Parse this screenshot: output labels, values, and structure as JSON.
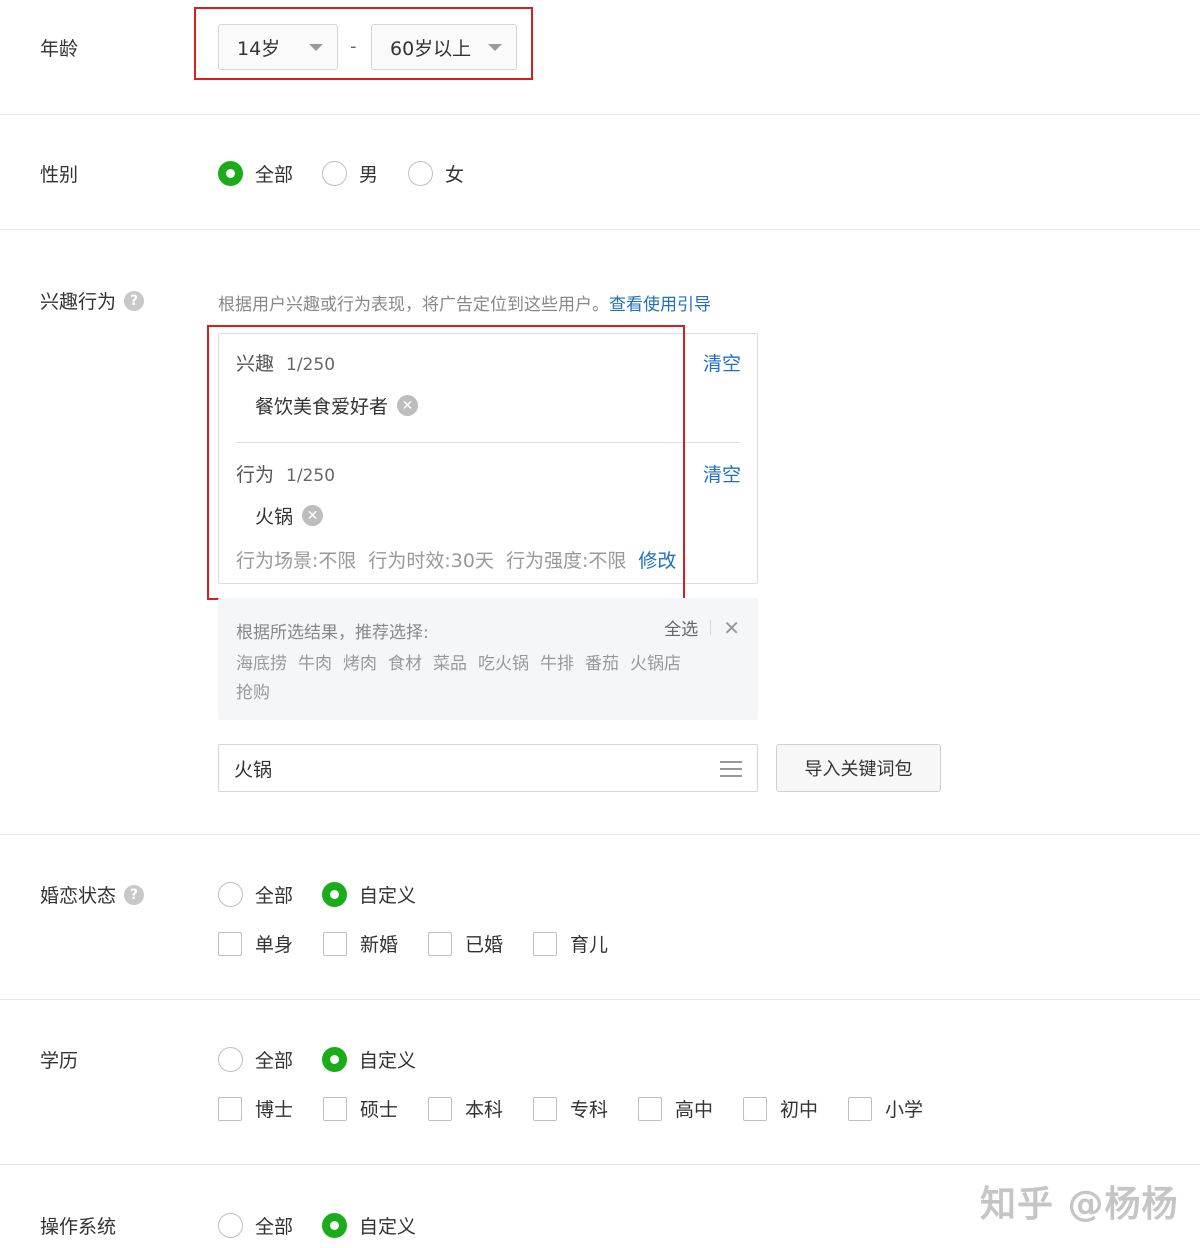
{
  "age": {
    "label": "年龄",
    "from": "14岁",
    "to": "60岁以上",
    "separator": "-"
  },
  "gender": {
    "label": "性别",
    "options": [
      {
        "label": "全部",
        "selected": true
      },
      {
        "label": "男",
        "selected": false
      },
      {
        "label": "女",
        "selected": false
      }
    ]
  },
  "interest_behavior": {
    "label": "兴趣行为",
    "help_icon": "question-circle-icon",
    "description": "根据用户兴趣或行为表现，将广告定位到这些用户。",
    "guide_link": "查看使用引导",
    "interest": {
      "title": "兴趣",
      "count": "1/250",
      "clear": "清空",
      "tags": [
        "餐饮美食爱好者"
      ]
    },
    "behavior": {
      "title": "行为",
      "count": "1/250",
      "clear": "清空",
      "tags": [
        "火锅"
      ],
      "params": [
        "行为场景:不限",
        "行为时效:30天",
        "行为强度:不限"
      ],
      "modify": "修改"
    },
    "recommend": {
      "title": "根据所选结果，推荐选择:",
      "select_all": "全选",
      "close_icon": "close-icon",
      "words": [
        "海底捞",
        "牛肉",
        "烤肉",
        "食材",
        "菜品",
        "吃火锅",
        "牛排",
        "番茄",
        "火锅店",
        "抢购"
      ]
    },
    "keyword_input": "火锅",
    "import_button": "导入关键词包"
  },
  "marital": {
    "label": "婚恋状态",
    "help_icon": "question-circle-icon",
    "options": [
      {
        "label": "全部",
        "selected": false
      },
      {
        "label": "自定义",
        "selected": true
      }
    ],
    "checkboxes": [
      "单身",
      "新婚",
      "已婚",
      "育儿"
    ]
  },
  "education": {
    "label": "学历",
    "options": [
      {
        "label": "全部",
        "selected": false
      },
      {
        "label": "自定义",
        "selected": true
      }
    ],
    "checkboxes": [
      "博士",
      "硕士",
      "本科",
      "专科",
      "高中",
      "初中",
      "小学"
    ]
  },
  "os": {
    "label": "操作系统",
    "options": [
      {
        "label": "全部",
        "selected": false
      },
      {
        "label": "自定义",
        "selected": true
      }
    ]
  },
  "watermark": "知乎 @杨杨",
  "colors": {
    "accent_green": "#1aad19",
    "link_blue": "#1f6fc2",
    "highlight_red": "#d91e1e"
  }
}
